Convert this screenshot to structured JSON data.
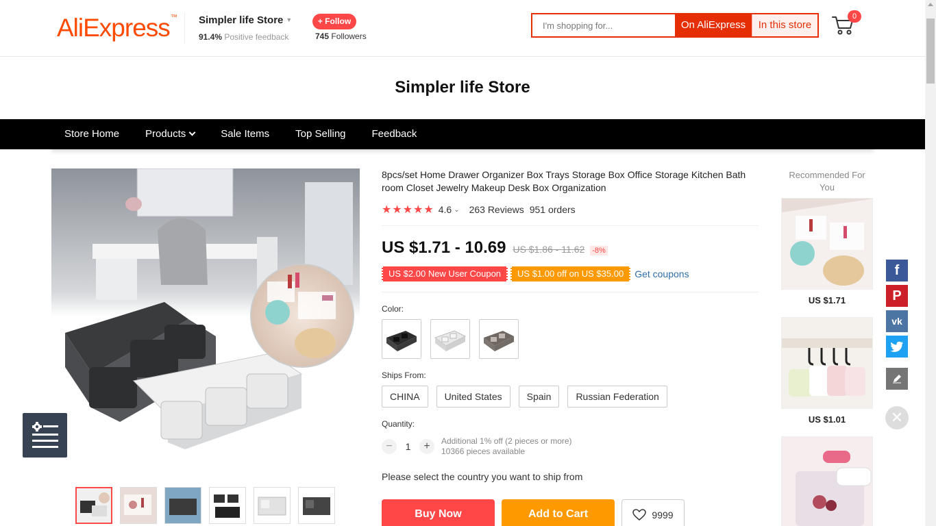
{
  "header": {
    "logo_text": "AliExpress",
    "store_name": "Simpler life Store",
    "feedback_percent": "91.4%",
    "feedback_label": "Positive feedback",
    "follow_label": "+ Follow",
    "followers_count": "745",
    "followers_label": "Followers",
    "search_placeholder": "I'm shopping for...",
    "search_on_ali": "On AliExpress",
    "search_in_store": "In this store",
    "cart_count": "0"
  },
  "banner": {
    "store_title": "Simpler life Store"
  },
  "nav": {
    "items": [
      {
        "label": "Store Home"
      },
      {
        "label": "Products"
      },
      {
        "label": "Sale Items"
      },
      {
        "label": "Top Selling"
      },
      {
        "label": "Feedback"
      }
    ]
  },
  "product": {
    "title": "8pcs/set Home Drawer Organizer Box Trays Storage Box Office Storage Kitchen Bath room Closet Jewelry Makeup Desk Box Organization",
    "rating": "4.6",
    "reviews": "263 Reviews",
    "orders": "951 orders",
    "price": "US $1.71 - 10.69",
    "price_old": "US $1.86 - 11.62",
    "discount": "-8%",
    "coupon_new_user": "US $2.00 New User Coupon",
    "coupon_off": "US $1.00 off on US $35.00",
    "get_coupons": "Get coupons",
    "color_label": "Color:",
    "ships_from_label": "Ships From:",
    "ships_from": [
      "CHINA",
      "United States",
      "Spain",
      "Russian Federation"
    ],
    "quantity_label": "Quantity:",
    "quantity": "1",
    "qty_note_1": "Additional 1% off (2 pieces or more)",
    "qty_note_2": "10366 pieces available",
    "ship_message": "Please select the country you want to ship from",
    "buy_now": "Buy Now",
    "add_to_cart": "Add to Cart",
    "wishlist_count": "9999"
  },
  "recommend": {
    "title": "Recommended For You",
    "items": [
      {
        "price": "US $1.71"
      },
      {
        "price": "US $1.01"
      }
    ]
  },
  "colors": {
    "accent": "#ff4747",
    "brand": "#ff4a00",
    "search_red": "#e62e04",
    "orange": "#ff9900",
    "link": "#2e6ea9",
    "facebook": "#3b5998",
    "pinterest": "#cb2027",
    "vk": "#4c75a3",
    "twitter": "#1da1f2",
    "edit": "#757575"
  },
  "icons": {
    "cart": "shopping-cart-icon",
    "heart": "heart-icon",
    "facebook": "facebook-icon",
    "pinterest": "pinterest-icon",
    "vk": "vk-icon",
    "twitter": "twitter-icon",
    "edit": "pencil-icon",
    "close": "close-icon",
    "menu": "settings-list-icon"
  }
}
